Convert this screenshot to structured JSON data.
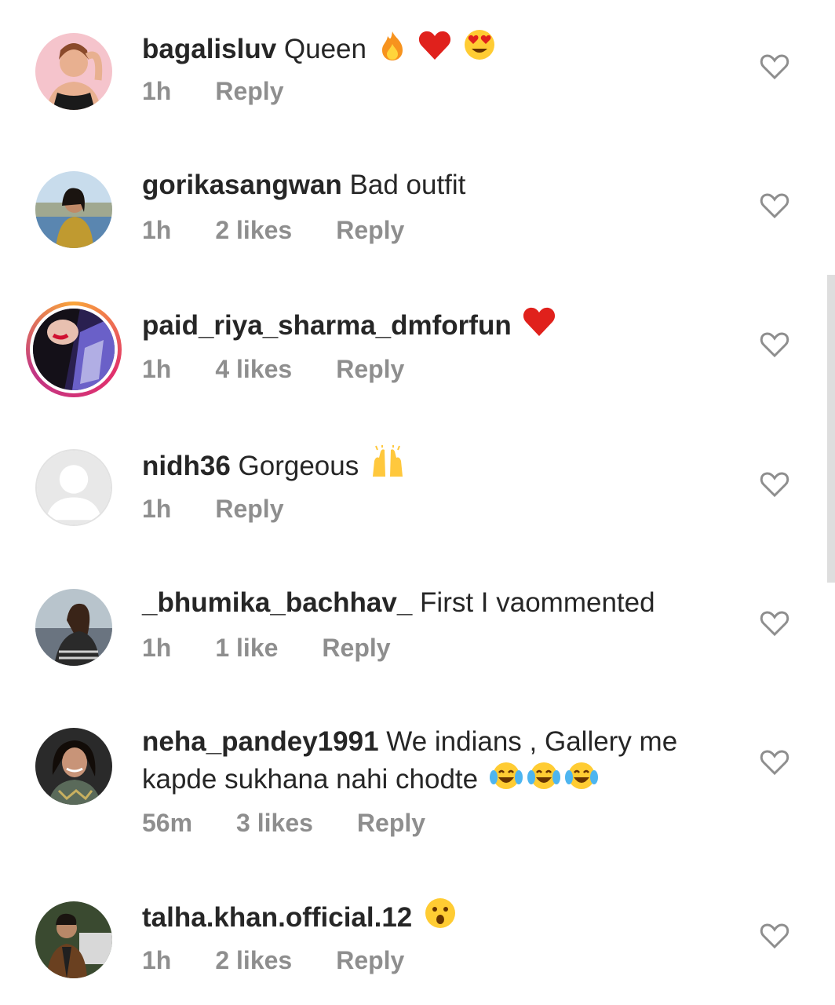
{
  "comments": [
    {
      "username": "bagalisluv",
      "text": "Queen",
      "emojis": [
        "fire",
        "red-heart",
        "heart-eyes"
      ],
      "time": "1h",
      "likes": "",
      "reply": "Reply"
    },
    {
      "username": "gorikasangwan",
      "text": "Bad outfit",
      "emojis": [],
      "time": "1h",
      "likes": "2 likes",
      "reply": "Reply"
    },
    {
      "username": "paid_riya_sharma_dmforfun",
      "text": "",
      "emojis": [
        "red-heart"
      ],
      "time": "1h",
      "likes": "4 likes",
      "reply": "Reply"
    },
    {
      "username": "nidh36",
      "text": "Gorgeous",
      "emojis": [
        "raising-hands"
      ],
      "time": "1h",
      "likes": "",
      "reply": "Reply"
    },
    {
      "username": "_bhumika_bachhav_",
      "text": "First I vaommented",
      "emojis": [],
      "time": "1h",
      "likes": "1 like",
      "reply": "Reply"
    },
    {
      "username": "neha_pandey1991",
      "text": "We indians , Gallery me kapde sukhana nahi chodte",
      "emojis": [
        "tears-of-joy",
        "tears-of-joy",
        "tears-of-joy"
      ],
      "time": "56m",
      "likes": "3 likes",
      "reply": "Reply"
    },
    {
      "username": "talha.khan.official.12",
      "text": "",
      "emojis": [
        "astonished"
      ],
      "time": "1h",
      "likes": "2 likes",
      "reply": "Reply"
    }
  ],
  "colors": {
    "text": "#262626",
    "meta": "#8e8e8e",
    "heart_outline": "#8e8e8e"
  }
}
